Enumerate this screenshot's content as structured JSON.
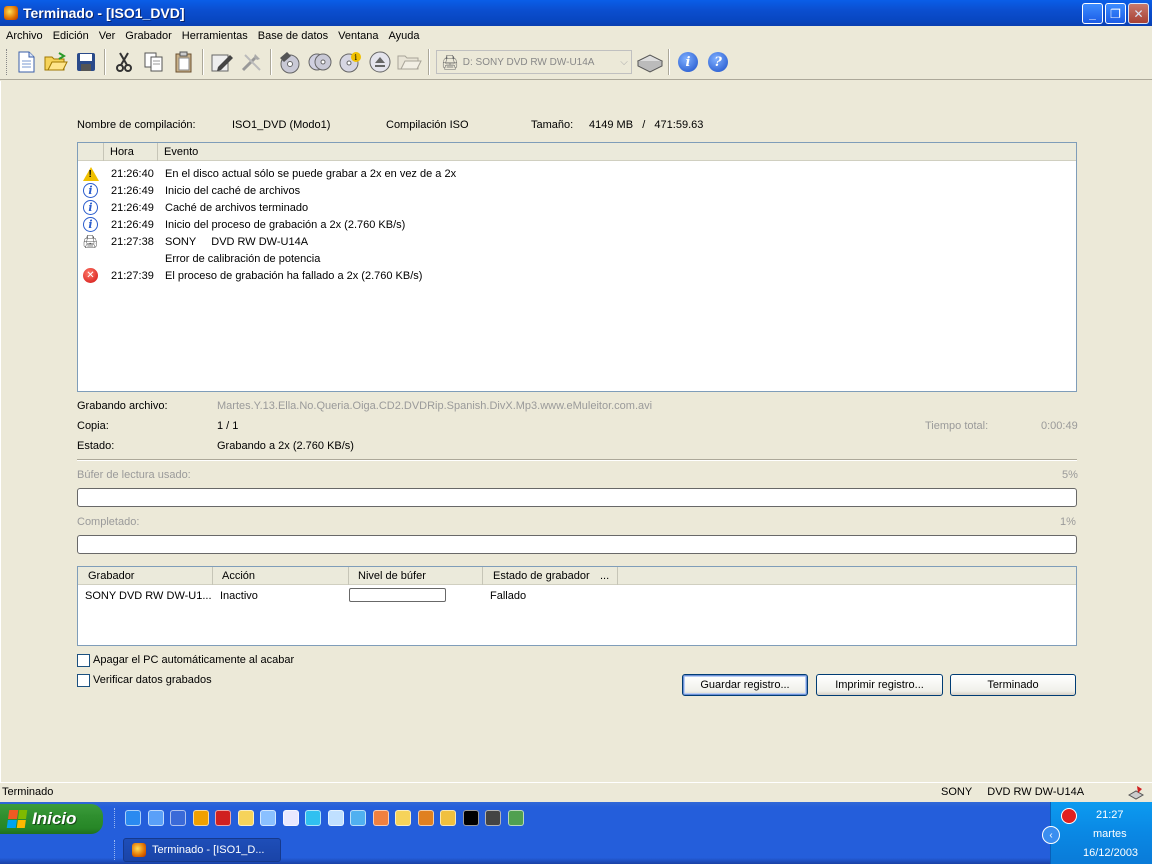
{
  "window": {
    "title": "Terminado - [ISO1_DVD]",
    "minimize_label": "_",
    "restore_label": "❐",
    "close_label": "✕"
  },
  "menu": [
    "Archivo",
    "Edición",
    "Ver",
    "Grabador",
    "Herramientas",
    "Base de datos",
    "Ventana",
    "Ayuda"
  ],
  "toolbar": {
    "drive_label": "D: SONY    DVD RW DW-U14A",
    "help_icon": "help-icon",
    "info_icon": "info-icon",
    "info_glyph": "i",
    "help_glyph": "?"
  },
  "compilation": {
    "name_label": "Nombre de compilación:",
    "name_value": "ISO1_DVD (Modo1)",
    "type_value": "Compilación ISO",
    "size_label": "Tamaño:",
    "size_value": "4149 MB   /   471:59.63"
  },
  "log": {
    "col_time": "Hora",
    "col_event": "Evento",
    "rows": [
      {
        "icon": "warning-icon",
        "time": "21:26:40",
        "event": "En el disco actual sólo se puede grabar a 2x en vez de a 2x"
      },
      {
        "icon": "info-icon",
        "time": "21:26:49",
        "event": "Inicio del caché de archivos"
      },
      {
        "icon": "info-icon",
        "time": "21:26:49",
        "event": "Caché de archivos terminado"
      },
      {
        "icon": "info-icon",
        "time": "21:26:49",
        "event": "Inicio del proceso de grabación a 2x (2.760 KB/s)"
      },
      {
        "icon": "drive-icon",
        "time": "21:27:38",
        "event": "SONY     DVD RW DW-U14A"
      },
      {
        "icon": "",
        "time": "",
        "event": "Error de calibración de potencia"
      },
      {
        "icon": "error-icon",
        "time": "21:27:39",
        "event": "El proceso de grabación ha fallado a 2x (2.760 KB/s)"
      }
    ]
  },
  "status_info": {
    "file_label": "Grabando archivo:",
    "file_value": "Martes.Y.13.Ella.No.Queria.Oiga.CD2.DVDRip.Spanish.DivX.Mp3.www.eMuleitor.com.avi",
    "copy_label": "Copia:",
    "copy_value": "1 / 1",
    "total_time_label": "Tiempo total:",
    "total_time_value": "0:00:49",
    "state_label": "Estado:",
    "state_value": "Grabando a 2x (2.760 KB/s)"
  },
  "progress": {
    "buffer_label": "Búfer de lectura usado:",
    "buffer_percent": "5%",
    "buffer_fraction": 0.0,
    "completed_label": "Completado:",
    "completed_percent": "1%",
    "completed_fraction": 0.0
  },
  "recorders": {
    "col_recorder": "Grabador",
    "col_action": "Acción",
    "col_buffer": "Nivel de búfer",
    "col_state": "Estado de grabador",
    "col_more": "...",
    "rows": [
      {
        "recorder": "SONY DVD RW DW-U1...",
        "action": "Inactivo",
        "buffer_fraction": 0.0,
        "state": "Fallado"
      }
    ]
  },
  "options": {
    "shutdown_label": "Apagar el PC automáticamente al acabar",
    "verify_label": "Verificar datos grabados"
  },
  "buttons": {
    "save_log": "Guardar registro...",
    "print_log": "Imprimir registro...",
    "done": "Terminado"
  },
  "statusbar": {
    "left": "Terminado",
    "drive": "SONY     DVD RW DW-U14A"
  },
  "taskbar": {
    "start_label": "Inicio",
    "task_label": "Terminado - [ISO1_D...",
    "clock_time": "21:27",
    "clock_day": "martes",
    "clock_date": "16/12/2003",
    "expand_glyph": "‹"
  },
  "colors": {
    "title_bar": "#0a5ee8",
    "face": "#ece9d8",
    "progress_fill": "#2ec226",
    "taskbar": "#245edb",
    "start": "#2f8f2f"
  }
}
